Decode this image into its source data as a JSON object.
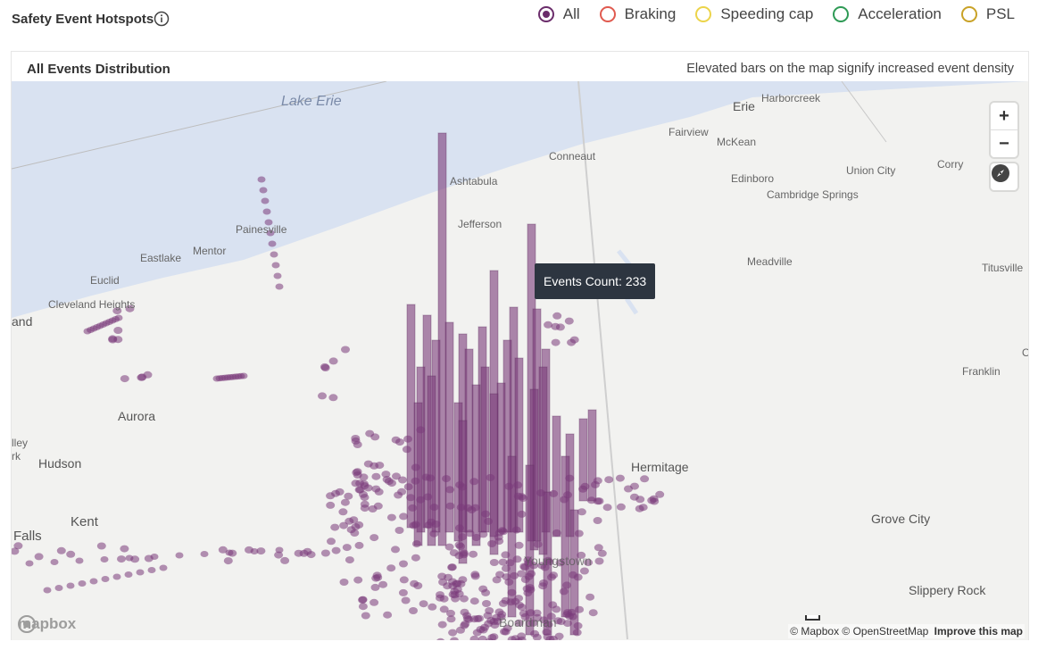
{
  "header": {
    "title": "Safety Event Hotspots",
    "info_icon": "info-circle-icon",
    "filters": [
      {
        "label": "All",
        "color": "#6b2d6b",
        "checked": true
      },
      {
        "label": "Braking",
        "color": "#e05a4f",
        "checked": false
      },
      {
        "label": "Speeding cap",
        "color": "#ecd44a",
        "checked": false
      },
      {
        "label": "Acceleration",
        "color": "#2e9a55",
        "checked": false
      },
      {
        "label": "PSL",
        "color": "#c9a227",
        "checked": false
      }
    ]
  },
  "card": {
    "title": "All Events Distribution",
    "note": "Elevated bars on the map signify increased event density"
  },
  "map": {
    "labels": {
      "lake_erie": "Lake Erie",
      "erie": "Erie",
      "harborcreek": "Harborcreek",
      "fairview": "Fairview",
      "mckean": "McKean",
      "conneaut": "Conneaut",
      "union_city": "Union City",
      "corry": "Corry",
      "edinboro": "Edinboro",
      "cambridge_springs": "Cambridge Springs",
      "ashtabula": "Ashtabula",
      "jefferson": "Jefferson",
      "painesville": "Painesville",
      "mentor": "Mentor",
      "eastlake": "Eastlake",
      "euclid": "Euclid",
      "cleveland_heights": "Cleveland Heights",
      "land": "and",
      "meadville": "Meadville",
      "titusville": "Titusville",
      "franklin": "Franklin",
      "aurora": "Aurora",
      "hudson": "Hudson",
      "valley": "lley",
      "park": "rk",
      "kent": "Kent",
      "falls": "Falls",
      "hermitage": "Hermitage",
      "youngstown": "Youngstown",
      "grove_city": "Grove City",
      "slippery_rock": "Slippery Rock",
      "boardman": "Boardman",
      "oil": "O"
    },
    "tooltip": "Events Count: 233",
    "zoom_in": "+",
    "zoom_out": "−",
    "compass_icon": "compass-icon",
    "logo": "mapbox",
    "attribution": "© Mapbox © OpenStreetMap",
    "improve_link": "Improve this map",
    "water_color": "#d9e2f1",
    "land_color": "#f2f2f0",
    "bar_color": "#7a3b7a"
  }
}
